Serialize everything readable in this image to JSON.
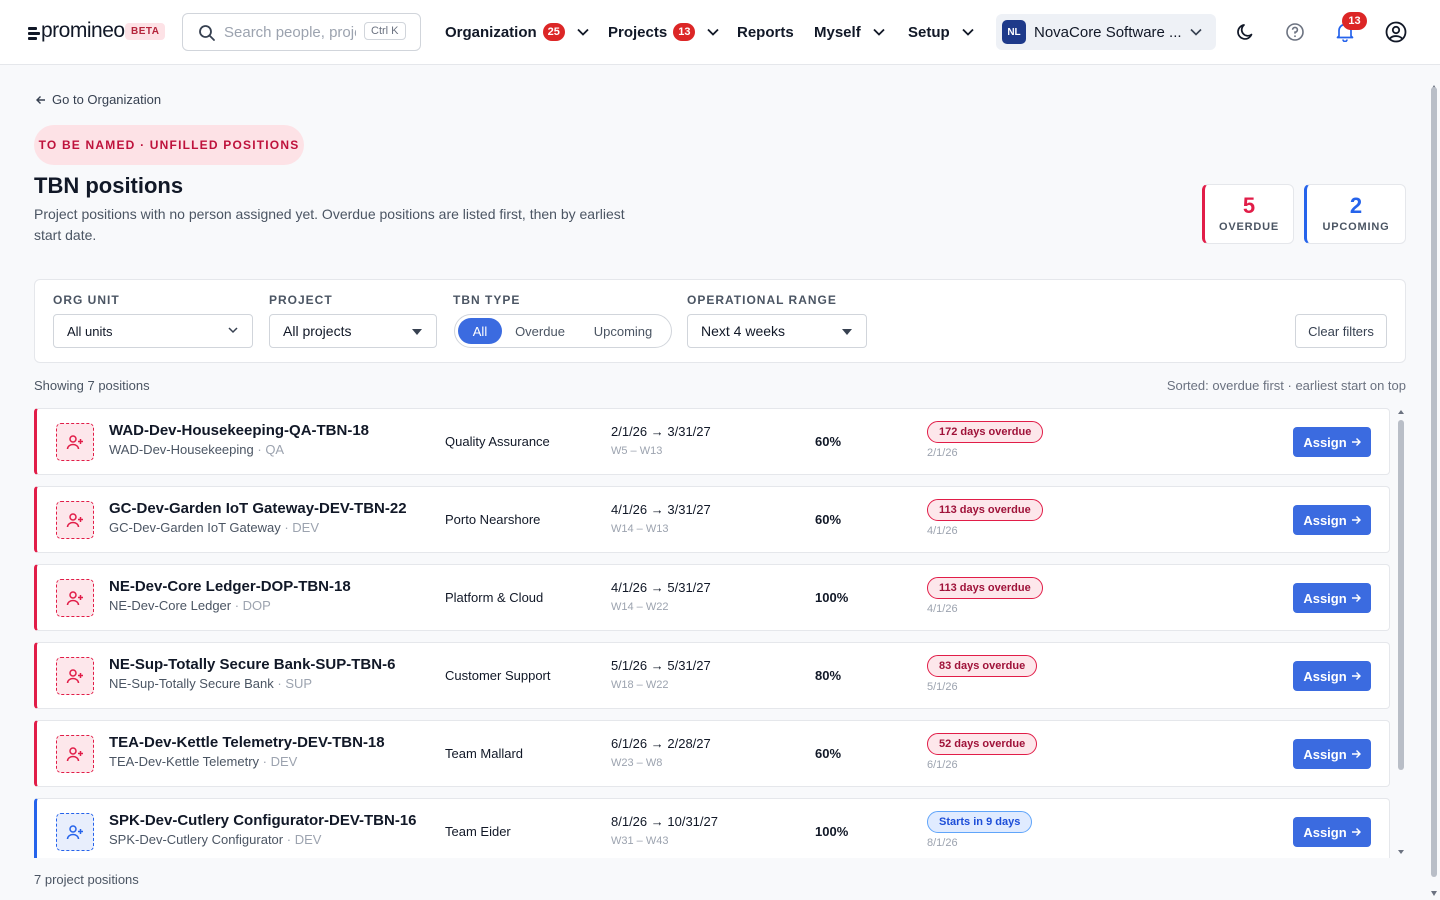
{
  "header": {
    "logo_text": "promineo",
    "beta_label": "BETA",
    "search_placeholder": "Search people, projects…",
    "search_shortcut": "Ctrl K",
    "nav": [
      {
        "label": "Organization",
        "badge": "25"
      },
      {
        "label": "Projects",
        "badge": "13"
      },
      {
        "label": "Reports"
      },
      {
        "label": "Myself"
      },
      {
        "label": "Setup"
      }
    ],
    "org": {
      "initials": "NL",
      "name": "NovaCore Software ..."
    },
    "notifications_count": "13"
  },
  "page": {
    "back_link": "Go to Organization",
    "tag": "TO BE NAMED · UNFILLED POSITIONS",
    "title": "TBN positions",
    "description": "Project positions with no person assigned yet. Overdue positions are listed first, then by earliest start date.",
    "stats": {
      "overdue": {
        "value": "5",
        "label": "OVERDUE"
      },
      "upcoming": {
        "value": "2",
        "label": "UPCOMING"
      }
    }
  },
  "filters": {
    "org_unit": {
      "label": "ORG UNIT",
      "value": "All units"
    },
    "project": {
      "label": "PROJECT",
      "value": "All projects"
    },
    "tbn_type": {
      "label": "TBN TYPE",
      "options": [
        "All",
        "Overdue",
        "Upcoming"
      ],
      "selected": "All"
    },
    "range": {
      "label": "OPERATIONAL RANGE",
      "value": "Next 4 weeks"
    },
    "clear_label": "Clear filters"
  },
  "list": {
    "showing": "Showing 7 positions",
    "sorted": "Sorted: overdue first · earliest start on top",
    "assign_label": "Assign",
    "rows": [
      {
        "status": "overdue",
        "title": "WAD-Dev-Housekeeping-QA-TBN-18",
        "project": "WAD-Dev-Housekeeping",
        "code": "QA",
        "unit": "Quality Assurance",
        "dates": "2/1/26 → 3/31/27",
        "weeks": "W5 – W13",
        "pct": "60%",
        "badge": "172 days overdue",
        "badge_date": "2/1/26"
      },
      {
        "status": "overdue",
        "title": "GC-Dev-Garden IoT Gateway-DEV-TBN-22",
        "project": "GC-Dev-Garden IoT Gateway",
        "code": "DEV",
        "unit": "Porto Nearshore",
        "dates": "4/1/26 → 3/31/27",
        "weeks": "W14 – W13",
        "pct": "60%",
        "badge": "113 days overdue",
        "badge_date": "4/1/26"
      },
      {
        "status": "overdue",
        "title": "NE-Dev-Core Ledger-DOP-TBN-18",
        "project": "NE-Dev-Core Ledger",
        "code": "DOP",
        "unit": "Platform & Cloud",
        "dates": "4/1/26 → 5/31/27",
        "weeks": "W14 – W22",
        "pct": "100%",
        "badge": "113 days overdue",
        "badge_date": "4/1/26"
      },
      {
        "status": "overdue",
        "title": "NE-Sup-Totally Secure Bank-SUP-TBN-6",
        "project": "NE-Sup-Totally Secure Bank",
        "code": "SUP",
        "unit": "Customer Support",
        "dates": "5/1/26 → 5/31/27",
        "weeks": "W18 – W22",
        "pct": "80%",
        "badge": "83 days overdue",
        "badge_date": "5/1/26"
      },
      {
        "status": "overdue",
        "title": "TEA-Dev-Kettle Telemetry-DEV-TBN-18",
        "project": "TEA-Dev-Kettle Telemetry",
        "code": "DEV",
        "unit": "Team Mallard",
        "dates": "6/1/26 → 2/28/27",
        "weeks": "W23 – W8",
        "pct": "60%",
        "badge": "52 days overdue",
        "badge_date": "6/1/26"
      },
      {
        "status": "upcoming",
        "title": "SPK-Dev-Cutlery Configurator-DEV-TBN-16",
        "project": "SPK-Dev-Cutlery Configurator",
        "code": "DEV",
        "unit": "Team Eider",
        "dates": "8/1/26 → 10/31/27",
        "weeks": "W31 – W43",
        "pct": "100%",
        "badge": "Starts in 9 days",
        "badge_date": "8/1/26"
      }
    ],
    "footer": "7 project positions"
  },
  "colors": {
    "overdue": "#e11d48",
    "upcoming": "#2563eb",
    "primary": "#3b6be0"
  }
}
